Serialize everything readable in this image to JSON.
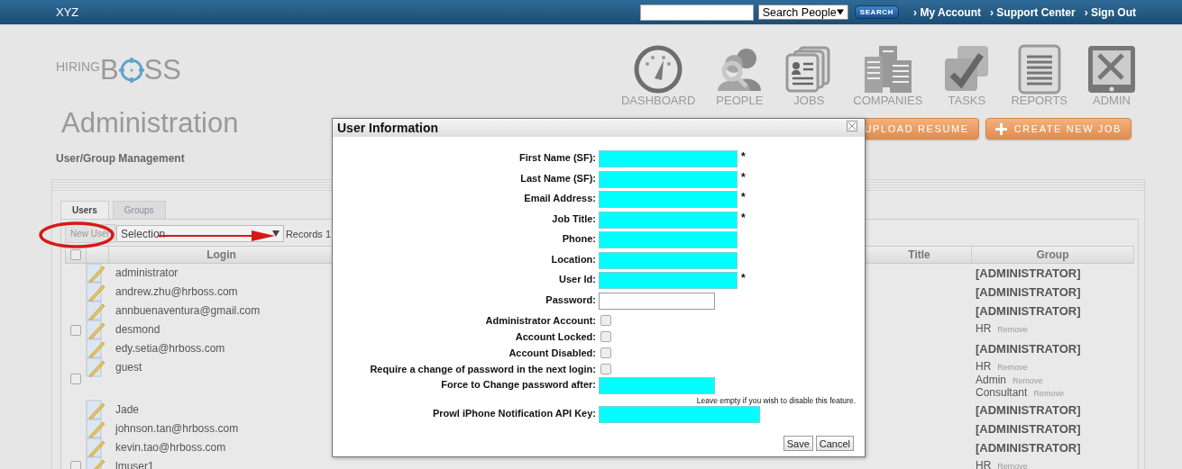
{
  "top_bar": {
    "brand": "XYZ",
    "search_scope": "Search People",
    "search_button": "SEARCH",
    "links": [
      "› My Account",
      "› Support Center",
      "› Sign Out"
    ]
  },
  "logo": {
    "prefix": "HIRING",
    "start": "B",
    "end": "SS"
  },
  "nav": [
    {
      "label": "DASHBOARD"
    },
    {
      "label": "PEOPLE"
    },
    {
      "label": "JOBS"
    },
    {
      "label": "COMPANIES"
    },
    {
      "label": "TASKS"
    },
    {
      "label": "REPORTS"
    },
    {
      "label": "ADMIN"
    }
  ],
  "actions": [
    {
      "label": "UPLOAD RESUME",
      "kind": "plain"
    },
    {
      "label": "CREATE NEW JOB",
      "kind": "add"
    }
  ],
  "page_title": "Administration",
  "section_title": "User/Group Management",
  "tabs": [
    {
      "label": "Users",
      "selected": true
    },
    {
      "label": "Groups",
      "selected": false
    }
  ],
  "toolbar": {
    "new_button": "New User",
    "selection": "Selection",
    "records": "Records 1"
  },
  "table": {
    "columns": {
      "login": "Login",
      "title": "Title",
      "group": "Group"
    },
    "select_all_checked": false,
    "rows": [
      {
        "login": "administrator",
        "selectable": false,
        "groups": [
          {
            "name": "[ADMINISTRATOR]",
            "kind": "admin"
          }
        ]
      },
      {
        "login": "andrew.zhu@hrboss.com",
        "selectable": false,
        "groups": [
          {
            "name": "[ADMINISTRATOR]",
            "kind": "admin"
          }
        ]
      },
      {
        "login": "annbuenaventura@gmail.com",
        "selectable": false,
        "groups": [
          {
            "name": "[ADMINISTRATOR]",
            "kind": "admin"
          }
        ]
      },
      {
        "login": "desmond",
        "selectable": true,
        "checked": false,
        "groups": [
          {
            "name": "HR",
            "kind": "member",
            "action": "Remove"
          }
        ]
      },
      {
        "login": "edy.setia@hrboss.com",
        "selectable": false,
        "groups": [
          {
            "name": "[ADMINISTRATOR]",
            "kind": "admin"
          }
        ]
      },
      {
        "login": "guest",
        "selectable": true,
        "checked": false,
        "groups": [
          {
            "name": "HR",
            "kind": "member",
            "action": "Remove"
          },
          {
            "name": "Admin",
            "kind": "member",
            "action": "Remove"
          },
          {
            "name": "Consultant",
            "kind": "member",
            "action": "Remove"
          }
        ]
      },
      {
        "login": "Jade",
        "selectable": false,
        "groups": [
          {
            "name": "[ADMINISTRATOR]",
            "kind": "admin"
          }
        ]
      },
      {
        "login": "johnson.tan@hrboss.com",
        "selectable": false,
        "groups": [
          {
            "name": "[ADMINISTRATOR]",
            "kind": "admin"
          }
        ]
      },
      {
        "login": "kevin.tao@hrboss.com",
        "selectable": false,
        "groups": [
          {
            "name": "[ADMINISTRATOR]",
            "kind": "admin"
          }
        ]
      },
      {
        "login": "lmuser1",
        "selectable": true,
        "checked": false,
        "groups": [
          {
            "name": "HR",
            "kind": "member",
            "action": "Remove"
          }
        ]
      }
    ]
  },
  "modal": {
    "title": "User Information",
    "fields": [
      {
        "label": "First Name (SF):",
        "kind": "text",
        "highlighted": true,
        "marker": "*"
      },
      {
        "label": "Last Name (SF):",
        "kind": "text",
        "highlighted": true,
        "marker": "*"
      },
      {
        "label": "Email Address:",
        "kind": "text",
        "highlighted": true,
        "marker": "*"
      },
      {
        "label": "Job Title:",
        "kind": "text",
        "highlighted": true,
        "marker": "*"
      },
      {
        "label": "Phone:",
        "kind": "text",
        "highlighted": true
      },
      {
        "label": "Location:",
        "kind": "text",
        "highlighted": true
      },
      {
        "label": "User Id:",
        "kind": "text",
        "highlighted": true,
        "marker": "*"
      },
      {
        "label": "Password:",
        "kind": "password",
        "highlighted": false
      },
      {
        "label": "Administrator Account:",
        "kind": "checkbox",
        "checked": false
      },
      {
        "label": "Account Locked:",
        "kind": "checkbox",
        "checked": false
      },
      {
        "label": "Account Disabled:",
        "kind": "checkbox",
        "checked": false
      },
      {
        "label": "Require a change of password in the next login:",
        "kind": "checkbox",
        "checked": false
      },
      {
        "label": "Force to Change password after:",
        "kind": "short",
        "highlighted": true,
        "hint": "Leave empty if you wish to disable this feature."
      },
      {
        "label": "Prowl iPhone Notification API Key:",
        "kind": "long",
        "highlighted": true
      }
    ],
    "buttons": [
      "Save",
      "Cancel"
    ]
  }
}
